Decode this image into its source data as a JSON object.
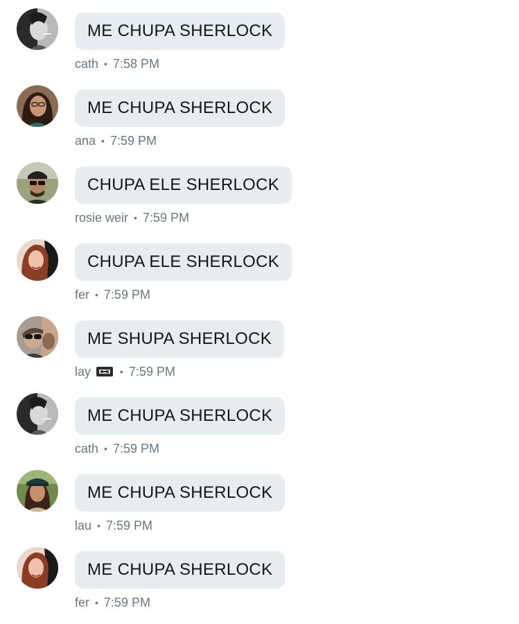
{
  "messages": [
    {
      "text": "ME CHUPA SHERLOCK",
      "author": "cath",
      "time": "7:58 PM",
      "avatar": "avatar-cath"
    },
    {
      "text": "ME CHUPA SHERLOCK",
      "author": "ana",
      "time": "7:59 PM",
      "avatar": "avatar-ana"
    },
    {
      "text": "CHUPA ELE SHERLOCK",
      "author": "rosie weir",
      "time": "7:59 PM",
      "avatar": "avatar-rosie-weir"
    },
    {
      "text": "CHUPA ELE SHERLOCK",
      "author": "fer",
      "time": "7:59 PM",
      "avatar": "avatar-fer"
    },
    {
      "text": "ME SHUPA SHERLOCK",
      "author": "lay",
      "author_icon": "videocassette-icon",
      "time": "7:59 PM",
      "avatar": "avatar-lay"
    },
    {
      "text": "ME CHUPA SHERLOCK",
      "author": "cath",
      "time": "7:59 PM",
      "avatar": "avatar-cath"
    },
    {
      "text": "ME CHUPA SHERLOCK",
      "author": "lau",
      "time": "7:59 PM",
      "avatar": "avatar-lau"
    },
    {
      "text": "ME CHUPA SHERLOCK",
      "author": "fer",
      "time": "7:59 PM",
      "avatar": "avatar-fer"
    }
  ],
  "separator": "•",
  "colors": {
    "bubble_bg": "#e6ecf0",
    "bubble_text": "#14171a",
    "meta_text": "#657786",
    "background": "#ffffff"
  }
}
